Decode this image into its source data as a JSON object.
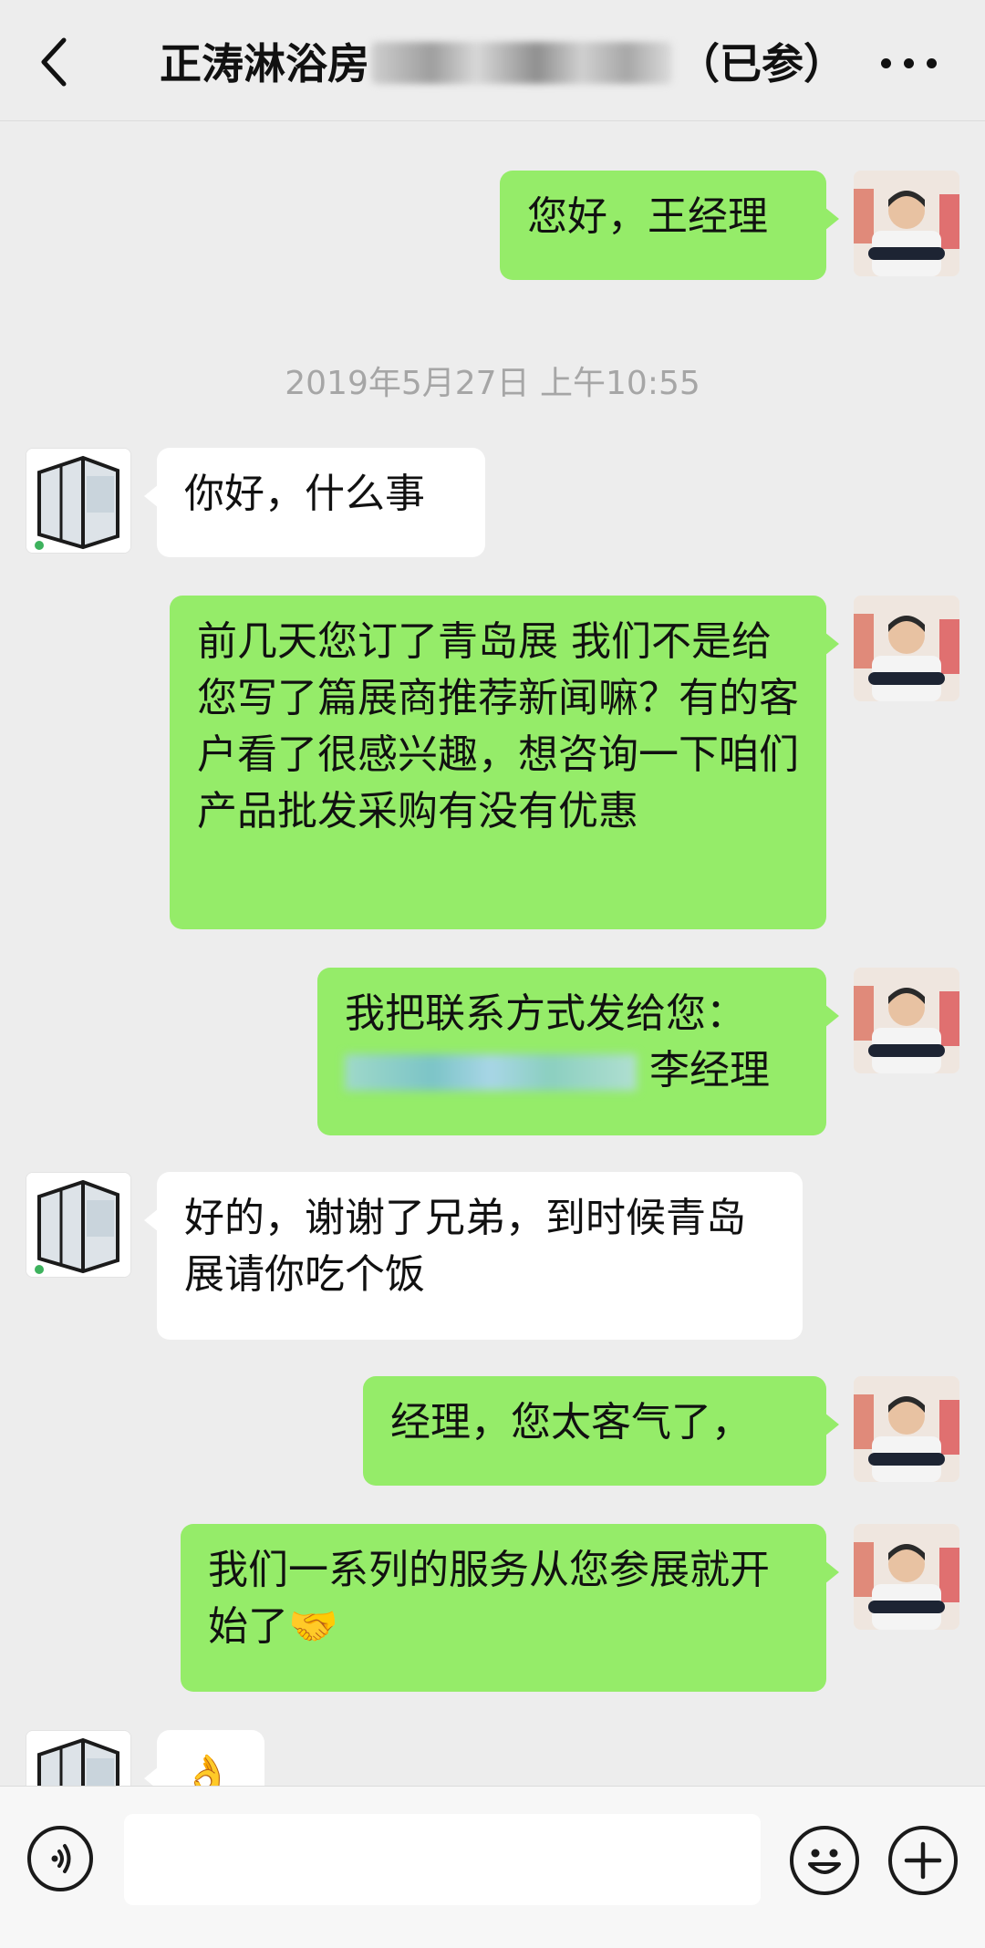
{
  "header": {
    "title_prefix": "正涛淋浴房",
    "title_suffix": "（已参）"
  },
  "chat": {
    "timestamp": "2019年5月27日 上午10:55",
    "messages": [
      {
        "from": "me",
        "text": "您好，王经理"
      },
      {
        "from": "contact",
        "text": "你好，什么事"
      },
      {
        "from": "me",
        "text": "前几天您订了青岛展 我们不是给您写了篇展商推荐新闻嘛？有的客户看了很感兴趣，想咨询一下咱们产品批发采购有没有优惠"
      },
      {
        "from": "me",
        "text_line1": "我把联系方式发给您：",
        "text_line2": "李经理"
      },
      {
        "from": "contact",
        "text": "好的，谢谢了兄弟，到时候青岛展请你吃个饭"
      },
      {
        "from": "me",
        "text": "经理，您太客气了，"
      },
      {
        "from": "me",
        "text": "我们一系列的服务从您参展就开始了",
        "emoji": "🤝"
      },
      {
        "from": "contact",
        "emoji": "👌"
      }
    ]
  },
  "input_bar": {
    "input_value": ""
  }
}
